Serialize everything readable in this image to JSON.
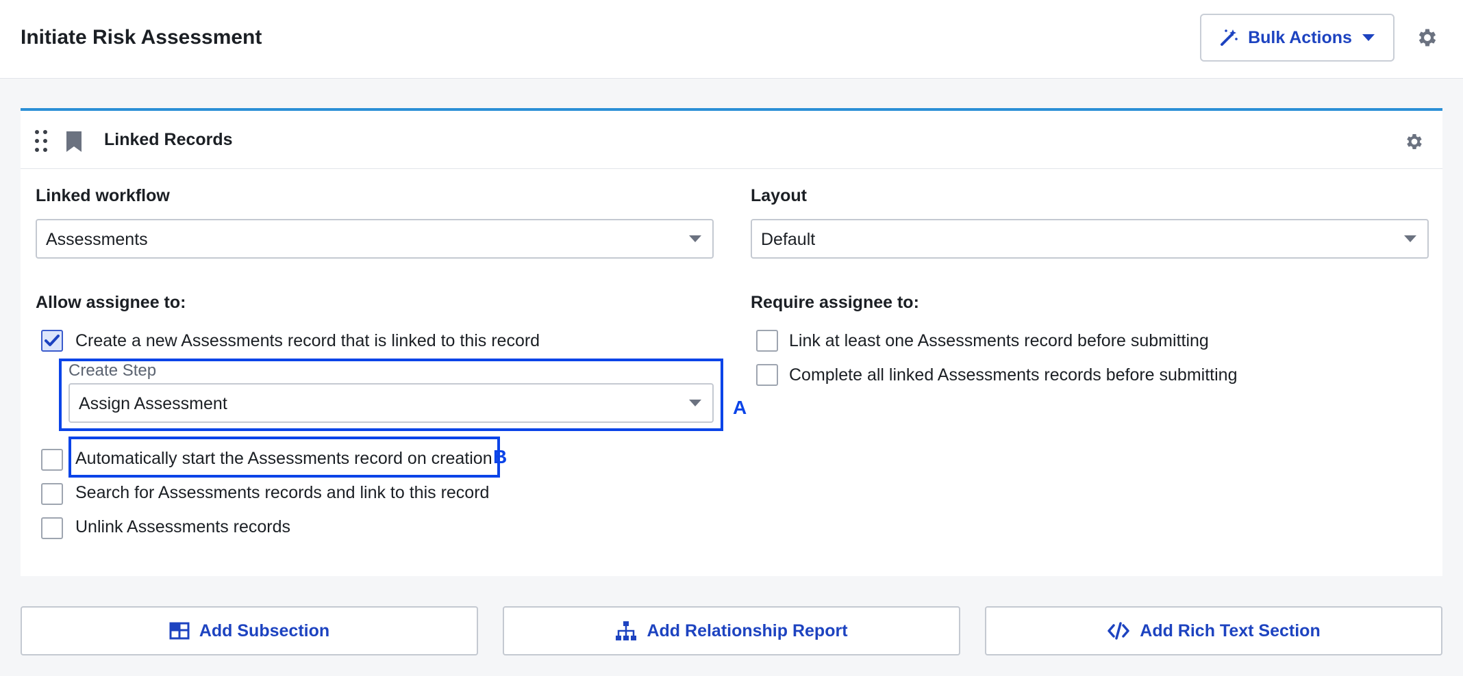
{
  "header": {
    "title": "Initiate Risk Assessment",
    "bulk_actions_label": "Bulk Actions",
    "bulk_icon": "magic-wand-icon",
    "settings_icon": "gear-icon"
  },
  "section": {
    "title": "Linked Records",
    "drag_icon": "drag-handle-icon",
    "type_icon": "bookmark-icon",
    "settings_icon": "gear-icon",
    "accent_color": "#2b8fd6"
  },
  "fields": {
    "linked_workflow_label": "Linked workflow",
    "linked_workflow_value": "Assessments",
    "layout_label": "Layout",
    "layout_value": "Default"
  },
  "allow": {
    "heading": "Allow assignee to:",
    "options": [
      {
        "label": "Create a new Assessments record that is linked to this record",
        "checked": true
      },
      {
        "label": "Automatically start the Assessments record on creation",
        "checked": false
      },
      {
        "label": "Search for Assessments records and link to this record",
        "checked": false
      },
      {
        "label": "Unlink Assessments records",
        "checked": false
      }
    ],
    "create_step_label": "Create Step",
    "create_step_value": "Assign Assessment"
  },
  "require": {
    "heading": "Require assignee to:",
    "options": [
      {
        "label": "Link at least one Assessments record before submitting",
        "checked": false
      },
      {
        "label": "Complete all linked Assessments records before submitting",
        "checked": false
      }
    ]
  },
  "callouts": {
    "a": "A",
    "b": "B",
    "color": "#0b44e8"
  },
  "bottom_buttons": {
    "subsection": "Add Subsection",
    "relationship": "Add Relationship Report",
    "rich_text": "Add Rich Text Section"
  }
}
